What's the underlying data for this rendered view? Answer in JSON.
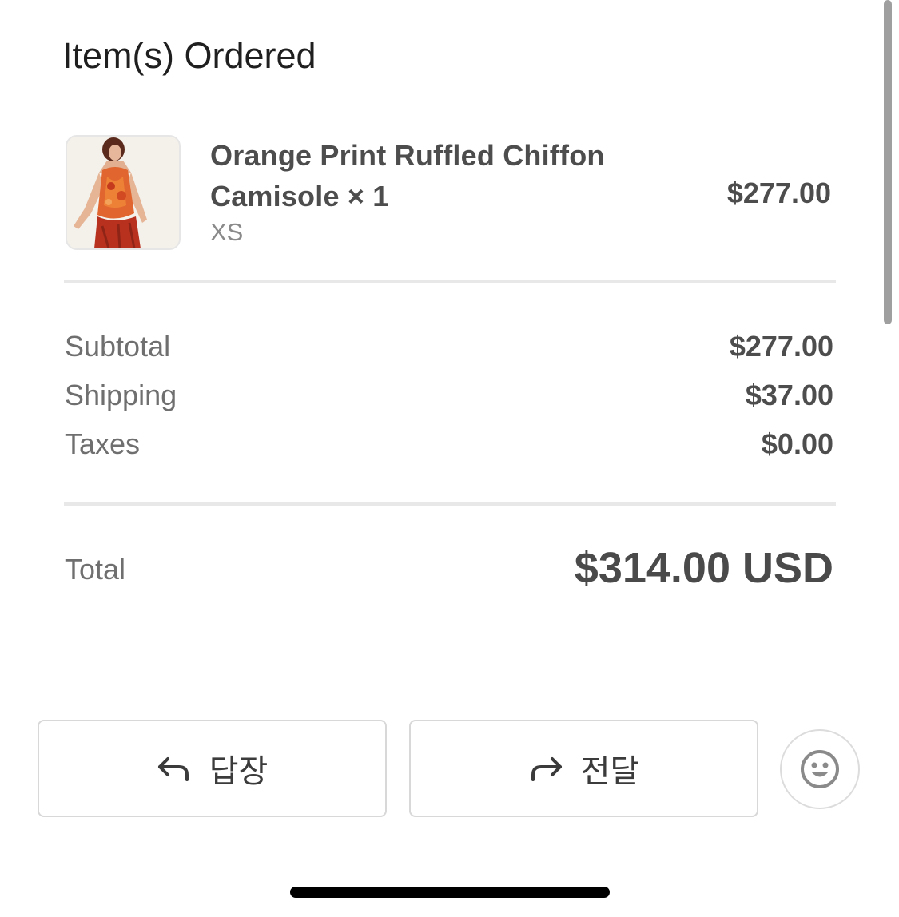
{
  "section": {
    "title": "Item(s) Ordered"
  },
  "item": {
    "name": "Orange Print Ruffled Chiffon Camisole × 1",
    "variant": "XS",
    "price": "$277.00",
    "image": "product-photo"
  },
  "summary": [
    {
      "label": "Subtotal",
      "value": "$277.00"
    },
    {
      "label": "Shipping",
      "value": "$37.00"
    },
    {
      "label": "Taxes",
      "value": "$0.00"
    }
  ],
  "total": {
    "label": "Total",
    "value": "$314.00 USD"
  },
  "actions": {
    "reply": {
      "label": "답장",
      "icon": "reply-arrow-icon"
    },
    "forward": {
      "label": "전달",
      "icon": "forward-arrow-icon"
    },
    "emoji": {
      "icon": "smiley-icon"
    }
  },
  "colors": {
    "text_primary": "#4d4d4d",
    "text_secondary": "#6f6f6f",
    "divider": "#e8e8e8",
    "button_border": "#d8d8d8",
    "product_orange": "#e0652e"
  }
}
